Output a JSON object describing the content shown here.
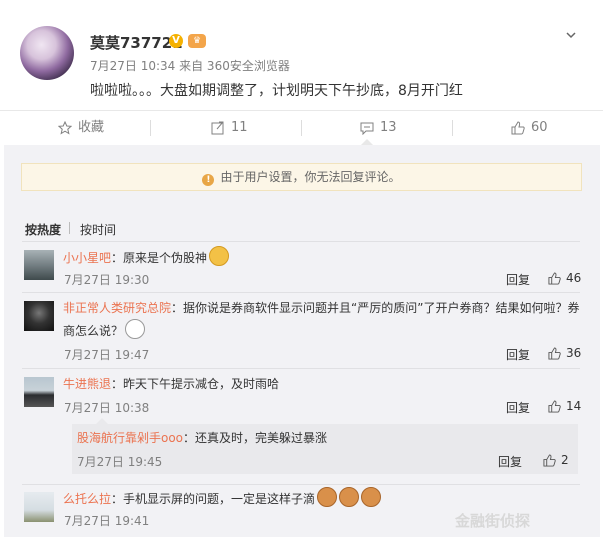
{
  "post": {
    "username": "莫莫737721",
    "meta": "7月27日 10:34 来自 360安全浏览器",
    "text": "啦啦啦。。。大盘如期调整了，计划明天下午抄底，8月开门红"
  },
  "actions": {
    "favorite_label": "收藏",
    "repost_count": "11",
    "comment_count": "13",
    "like_count": "60"
  },
  "notice": "由于用户设置，你无法回复评论。",
  "sort": {
    "hot": "按热度",
    "time": "按时间"
  },
  "comments": [
    {
      "name": "小小星吧",
      "text": "：原来是个伪股神",
      "date": "7月27日 19:30",
      "reply": "回复",
      "likes": "46"
    },
    {
      "name": "非正常人类研究总院",
      "text": "：据你说是券商软件显示问题并且“严厉的质问”了开户券商？结果如何啦？券",
      "text2": "商怎么说？",
      "date": "7月27日 19:47",
      "reply": "回复",
      "likes": "36"
    },
    {
      "name": "牛进熊退",
      "text": "：昨天下午提示减仓，及时雨哈",
      "date": "7月27日 10:38",
      "reply": "回复",
      "likes": "14"
    },
    {
      "name": "么托么拉",
      "text": "：手机显示屏的问题，一定是这样子滴",
      "date": "7月27日 19:41"
    }
  ],
  "subreply": {
    "name": "股海航行靠剁手ooo",
    "text": "：还真及时，完美躲过暴涨",
    "date": "7月27日 19:45",
    "reply": "回复",
    "likes": "2"
  },
  "watermark": "金融街侦探",
  "colors": {
    "name_orange": "#eb7350",
    "meta_gray": "#808080",
    "panel_bg": "#f2f2f5"
  }
}
